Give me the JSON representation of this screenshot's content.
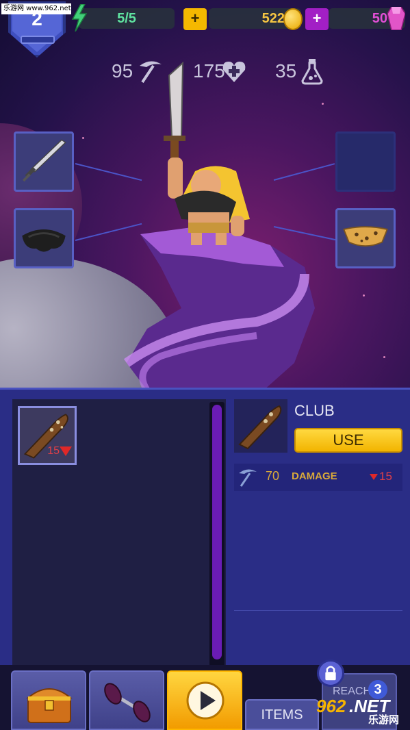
{
  "watermark": "乐游网 www.962.net",
  "player": {
    "level": "2"
  },
  "resources": {
    "energy": "5/5",
    "gold": "522",
    "gems": "50",
    "plus": "+"
  },
  "hero_stats": {
    "damage": "95",
    "health": "175",
    "potion": "35"
  },
  "inventory": {
    "items": [
      {
        "name": "club",
        "qty": "15"
      }
    ]
  },
  "detail": {
    "item_name": "CLUB",
    "use_label": "USE",
    "stat_value": "70",
    "stat_label": "DAMAGE",
    "stat_delta": "15"
  },
  "nav": {
    "items_label": "ITEMS",
    "reach_label": "REACH",
    "reach_level": "3"
  },
  "watermark_bottom": {
    "brand": "962",
    "site": ".NET",
    "cn": "乐游网"
  },
  "colors": {
    "energy": "#5fe3a0",
    "gold": "#f5c542",
    "gem": "#e24fd6",
    "use_button": "#f5c400",
    "panel": "#2a2d86"
  },
  "icons": [
    "bolt-icon",
    "coin-icon",
    "gem-icon",
    "pickaxe-icon",
    "heart-icon",
    "potion-icon",
    "lock-icon",
    "chest-icon",
    "dumbbell-icon",
    "play-icon"
  ]
}
